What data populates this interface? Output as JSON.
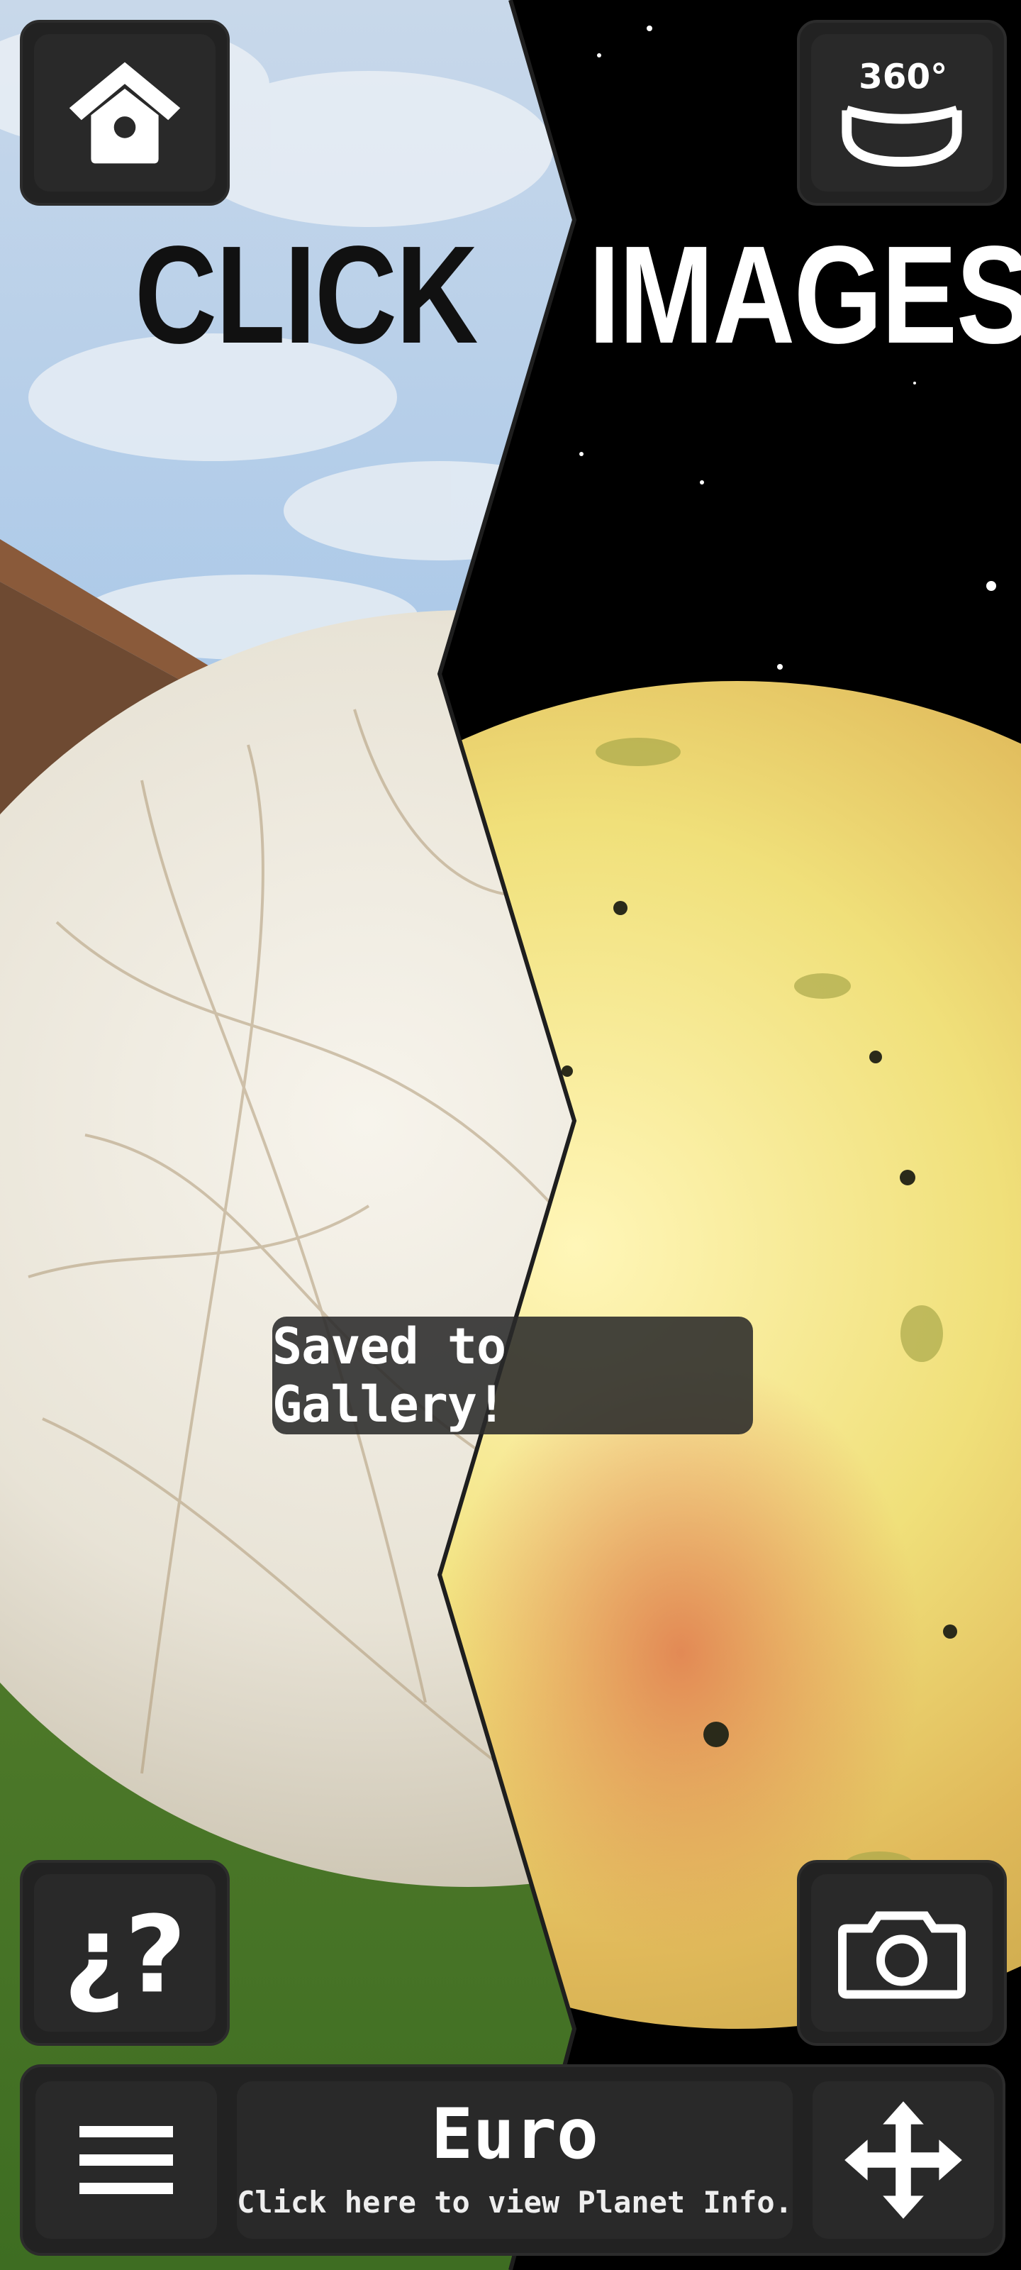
{
  "header": {
    "left_title": "CLICK",
    "right_title": "IMAGES",
    "home_icon": "home-icon",
    "view_360_icon": "view-360-icon",
    "view_360_text": "360°"
  },
  "toast": {
    "message": "Saved to Gallery!"
  },
  "controls": {
    "help_icon": "help-icon",
    "help_text": "¿?",
    "camera_icon": "camera-icon"
  },
  "bottom_bar": {
    "menu_icon": "menu-icon",
    "planet_name": "Euro",
    "planet_hint": "Click here to view Planet Info.",
    "move_icon": "move-icon"
  },
  "colors": {
    "panel": "#222222",
    "sky": "#a8c7e8",
    "space": "#000000"
  }
}
